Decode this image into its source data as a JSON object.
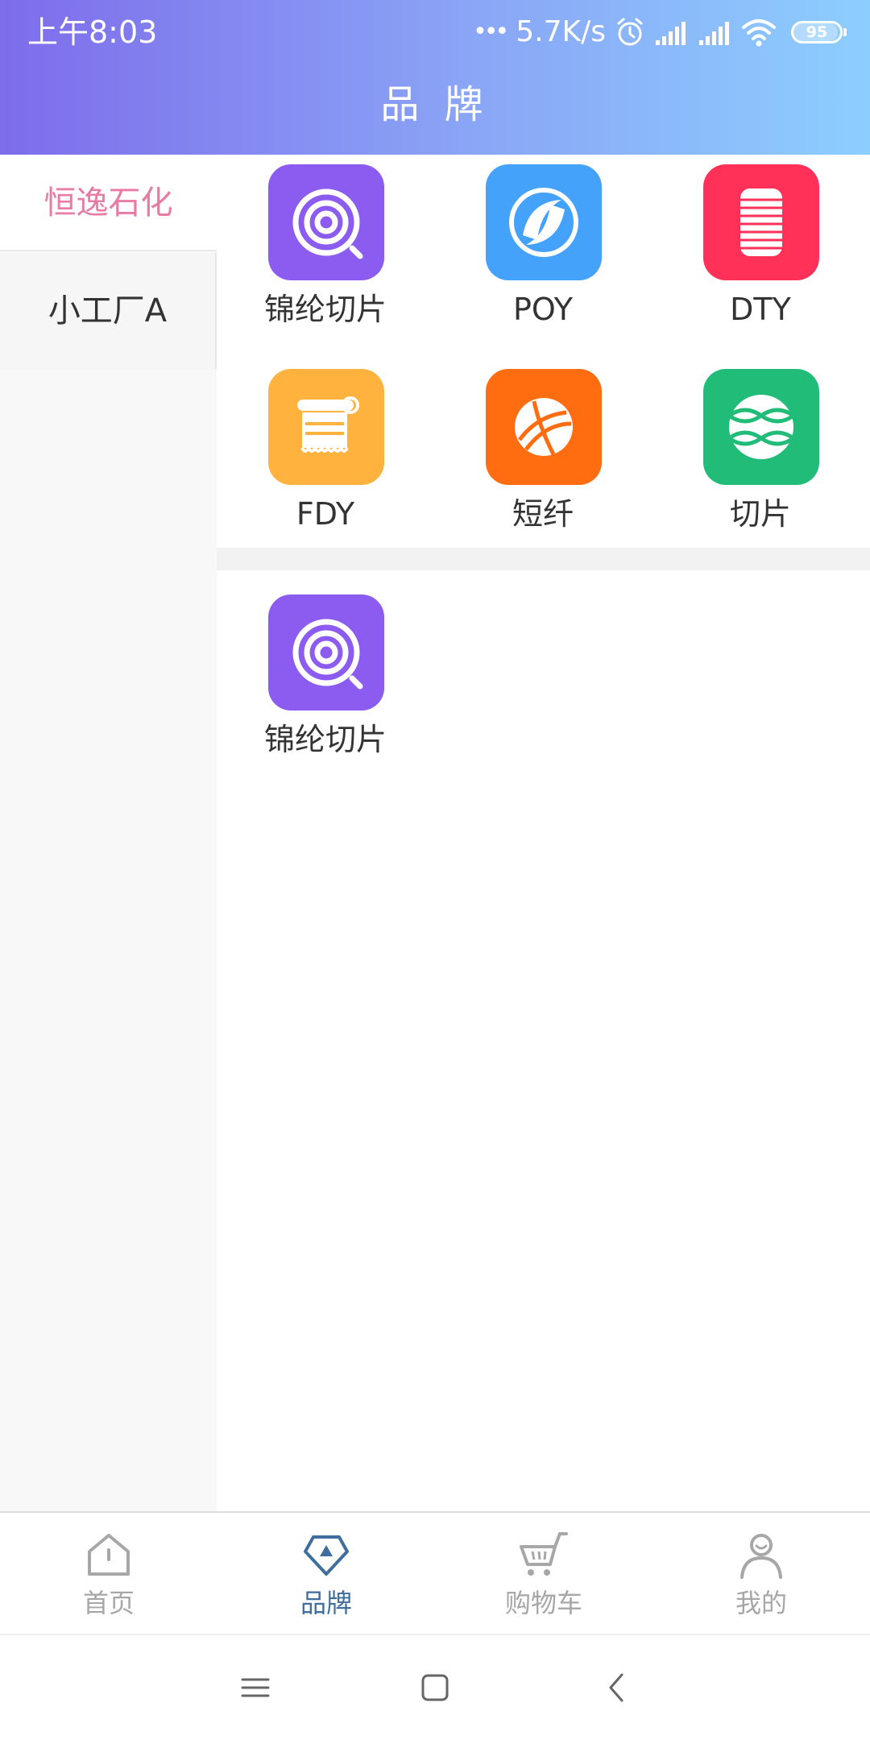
{
  "status_bar": {
    "time": "上午8:03",
    "dots": "•••",
    "network_speed": "5.7K/s",
    "battery_level": 95,
    "battery_text": "95"
  },
  "header": {
    "title": "品 牌",
    "gradient": [
      "#7E6CEB",
      "#8CCEFE"
    ]
  },
  "sidebar": {
    "items": [
      {
        "label": "恒逸石化",
        "selected": true
      },
      {
        "label": "小工厂A",
        "selected": false
      }
    ],
    "accent_color": "#E97AA4"
  },
  "sections": [
    {
      "items": [
        {
          "label": "锦纶切片",
          "icon": "spiral-icon",
          "color": "#8C5CF0"
        },
        {
          "label": "POY",
          "icon": "swirl-logo-icon",
          "color": "#44A2FB"
        },
        {
          "label": "DTY",
          "icon": "spool-icon",
          "color": "#FF3159"
        },
        {
          "label": "FDY",
          "icon": "fabric-roll-icon",
          "color": "#FFB23E"
        },
        {
          "label": "短纤",
          "icon": "yarn-ball-icon",
          "color": "#FF6D10"
        },
        {
          "label": "切片",
          "icon": "net-icon",
          "color": "#20BC78"
        }
      ]
    },
    {
      "items": [
        {
          "label": "锦纶切片",
          "icon": "spiral-icon",
          "color": "#8C5CF0"
        }
      ]
    }
  ],
  "tabbar": {
    "tabs": [
      {
        "label": "首页",
        "icon": "home-icon",
        "active": false
      },
      {
        "label": "品牌",
        "icon": "diamond-icon",
        "active": true
      },
      {
        "label": "购物车",
        "icon": "cart-icon",
        "active": false
      },
      {
        "label": "我的",
        "icon": "user-icon",
        "active": false
      }
    ],
    "active_color": "#3F6E9E",
    "inactive_color": "#A7A7A7"
  },
  "system_nav": {
    "buttons": [
      "menu-icon",
      "home-square-icon",
      "back-icon"
    ]
  }
}
